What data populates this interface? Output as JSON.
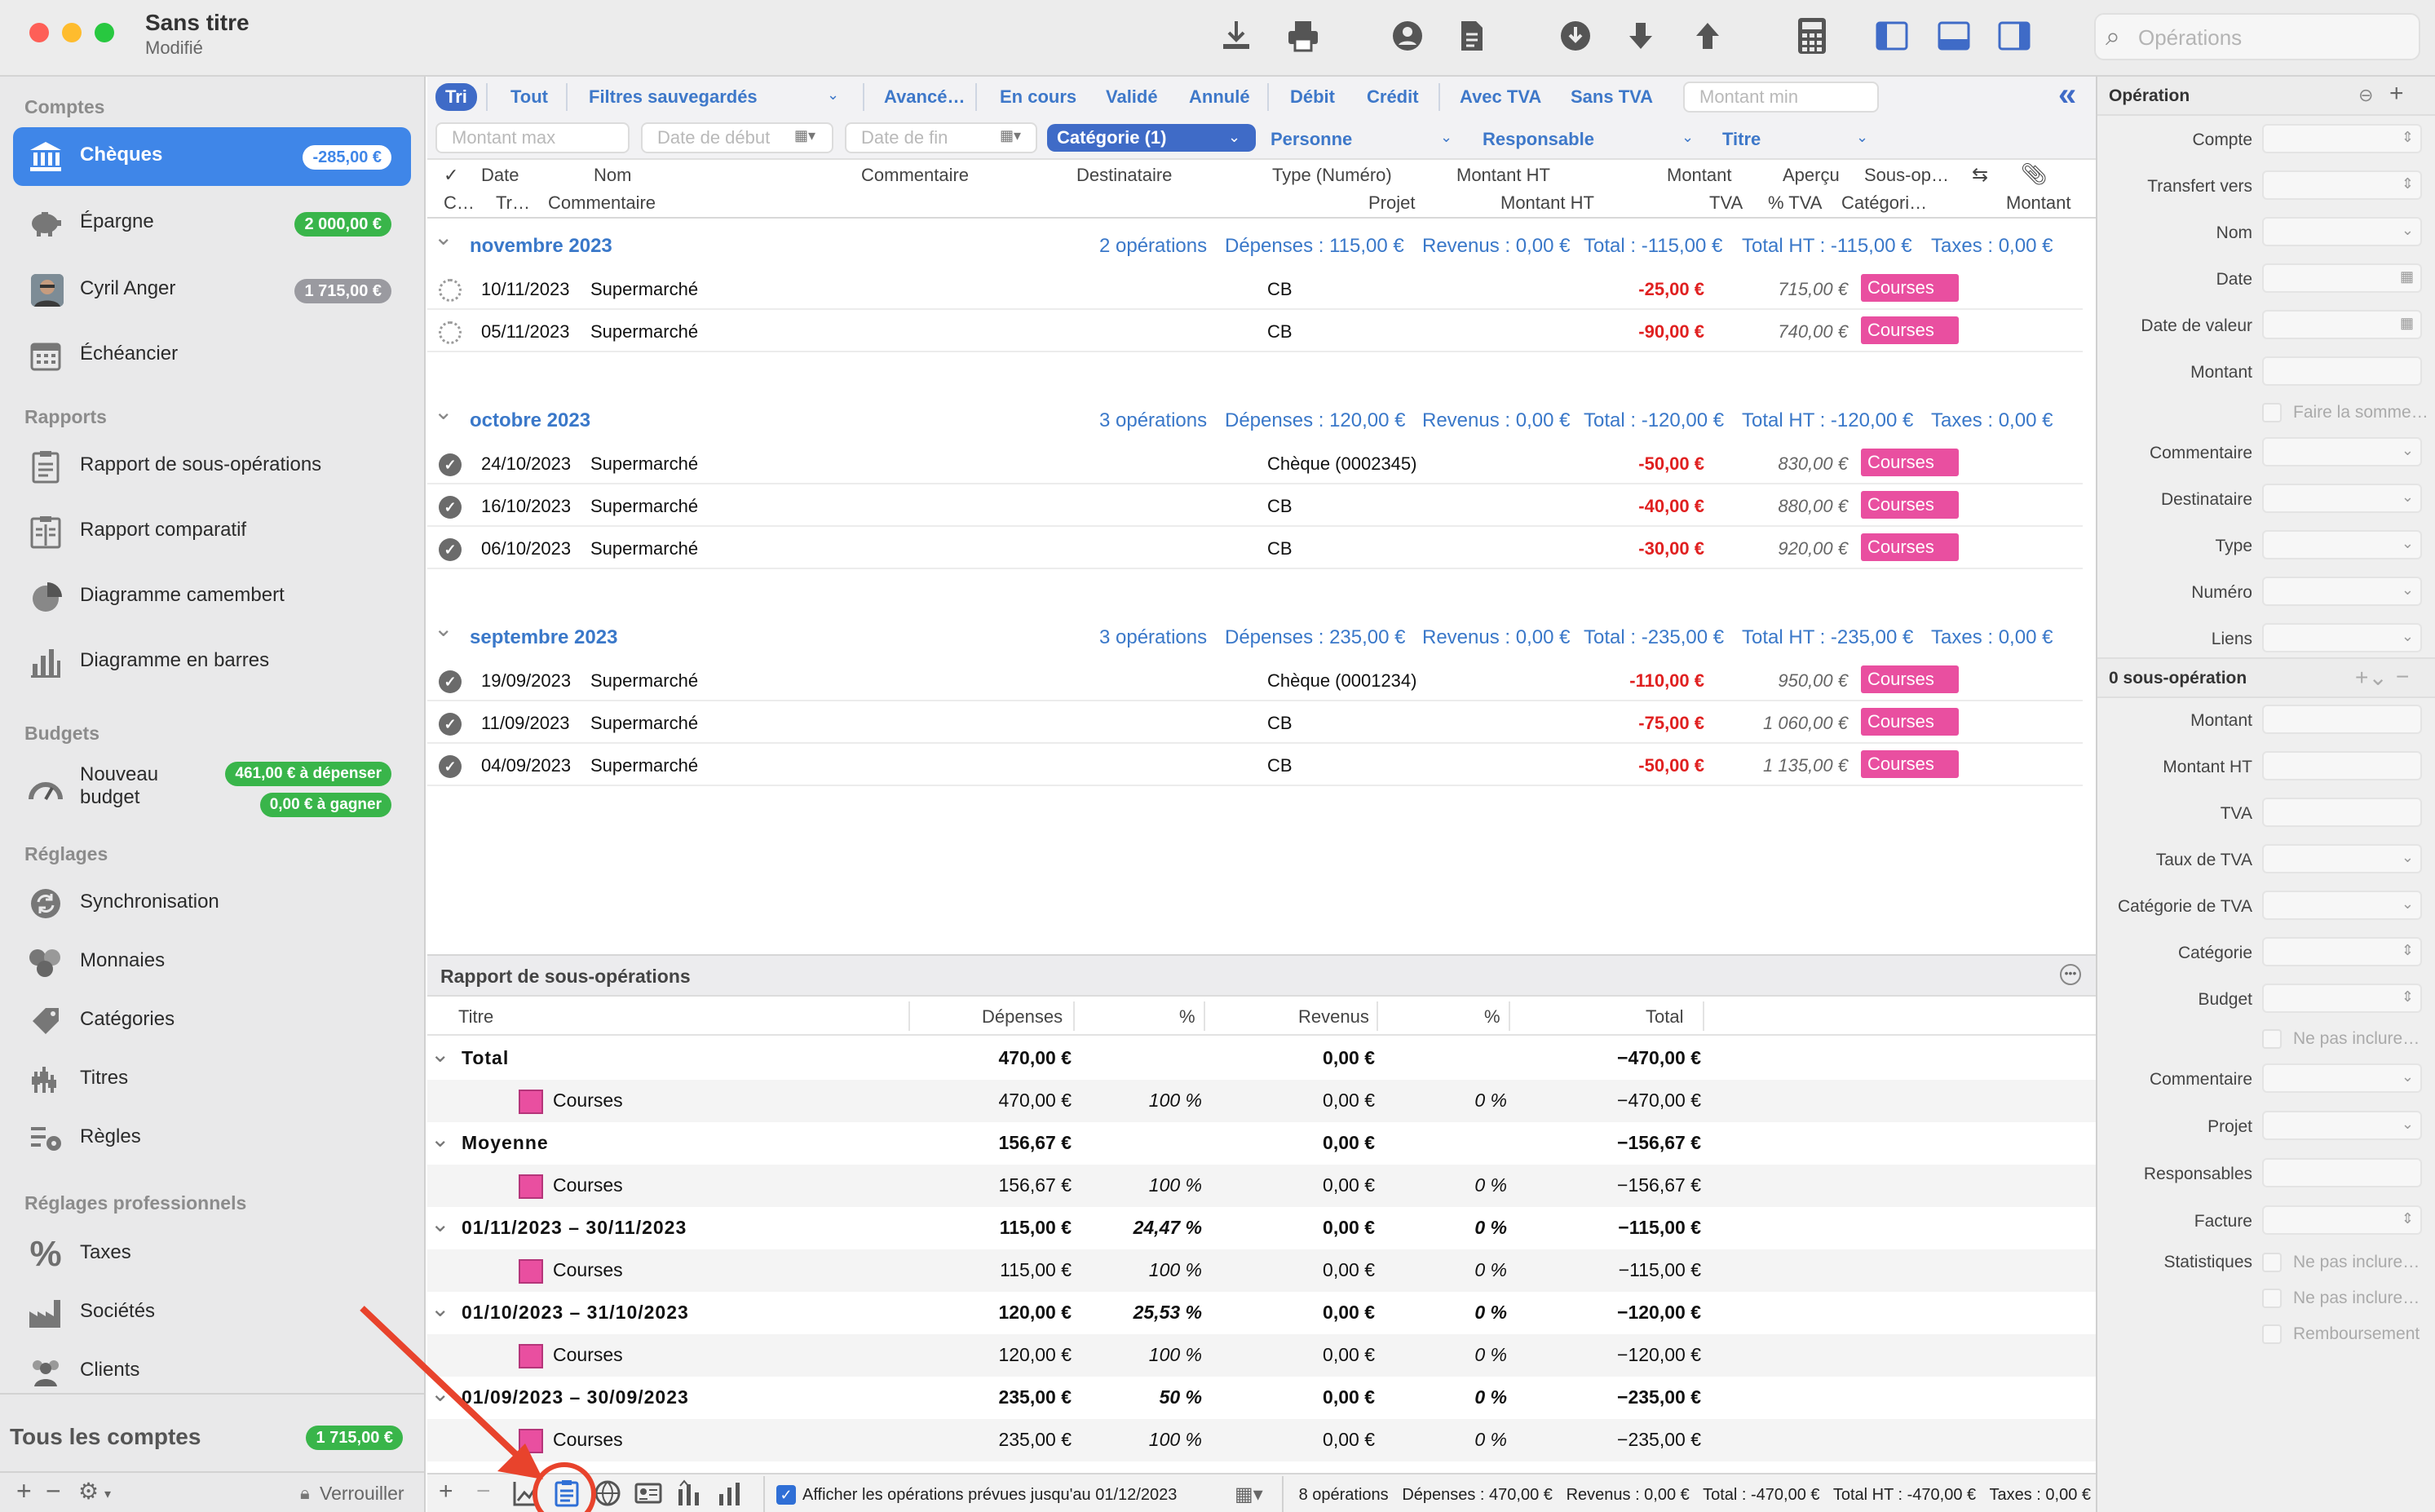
{
  "window": {
    "title": "Sans titre",
    "subtitle": "Modifié"
  },
  "toolbar": {
    "search_placeholder": "Opérations"
  },
  "sidebar": {
    "sec_comptes": "Comptes",
    "accounts": [
      {
        "label": "Chèques",
        "badge": "-285,00 €"
      },
      {
        "label": "Épargne",
        "badge": "2 000,00 €"
      },
      {
        "label": "Cyril Anger",
        "badge": "1 715,00 €"
      },
      {
        "label": "Échéancier"
      }
    ],
    "sec_rapports": "Rapports",
    "reports": [
      "Rapport de sous-opérations",
      "Rapport comparatif",
      "Diagramme camembert",
      "Diagramme en barres"
    ],
    "sec_budgets": "Budgets",
    "budget": {
      "label1": "Nouveau",
      "label2": "budget",
      "badge1": "461,00 € à dépenser",
      "badge2": "0,00 € à gagner"
    },
    "sec_reglages": "Réglages",
    "settings": [
      "Synchronisation",
      "Monnaies",
      "Catégories",
      "Titres",
      "Règles"
    ],
    "sec_pro": "Réglages professionnels",
    "pro": [
      "Taxes",
      "Sociétés",
      "Clients"
    ],
    "total_label": "Tous les comptes",
    "total_badge": "1 715,00 €",
    "lock": "Verrouiller"
  },
  "filters": {
    "row1": [
      "Tri",
      "Tout",
      "Filtres sauvegardés",
      "Avancé…",
      "En cours",
      "Validé",
      "Annulé",
      "Débit",
      "Crédit",
      "Avec TVA",
      "Sans TVA"
    ],
    "montant_min": "Montant min",
    "montant_max": "Montant max",
    "date_debut": "Date de début",
    "date_fin": "Date de fin",
    "categorie": "Catégorie (1)",
    "personne": "Personne",
    "responsable": "Responsable",
    "titre": "Titre"
  },
  "columns": {
    "r1": [
      "✓",
      "Date",
      "Nom",
      "Commentaire",
      "Destinataire",
      "Type (Numéro)",
      "Montant HT",
      "Montant",
      "Aperçu",
      "Sous-op…"
    ],
    "r2": [
      "C…",
      "Tr…",
      "Commentaire",
      "Projet",
      "Montant HT",
      "TVA",
      "% TVA",
      "Catégori…",
      "Montant"
    ]
  },
  "groups": [
    {
      "month": "novembre 2023",
      "count": "2 opérations",
      "dep": "Dépenses : 115,00 €",
      "rev": "Revenus : 0,00 €",
      "tot": "Total : -115,00 €",
      "tht": "Total HT : -115,00 €",
      "tax": "Taxes : 0,00 €",
      "rows": [
        {
          "date": "10/11/2023",
          "nom": "Supermarché",
          "type": "CB",
          "amt": "-25,00 €",
          "bal": "715,00 €",
          "cat": "Courses",
          "pending": true
        },
        {
          "date": "05/11/2023",
          "nom": "Supermarché",
          "type": "CB",
          "amt": "-90,00 €",
          "bal": "740,00 €",
          "cat": "Courses",
          "pending": true
        }
      ]
    },
    {
      "month": "octobre 2023",
      "count": "3 opérations",
      "dep": "Dépenses : 120,00 €",
      "rev": "Revenus : 0,00 €",
      "tot": "Total : -120,00 €",
      "tht": "Total HT : -120,00 €",
      "tax": "Taxes : 0,00 €",
      "rows": [
        {
          "date": "24/10/2023",
          "nom": "Supermarché",
          "type": "Chèque (0002345)",
          "amt": "-50,00 €",
          "bal": "830,00 €",
          "cat": "Courses"
        },
        {
          "date": "16/10/2023",
          "nom": "Supermarché",
          "type": "CB",
          "amt": "-40,00 €",
          "bal": "880,00 €",
          "cat": "Courses"
        },
        {
          "date": "06/10/2023",
          "nom": "Supermarché",
          "type": "CB",
          "amt": "-30,00 €",
          "bal": "920,00 €",
          "cat": "Courses"
        }
      ]
    },
    {
      "month": "septembre 2023",
      "count": "3 opérations",
      "dep": "Dépenses : 235,00 €",
      "rev": "Revenus : 0,00 €",
      "tot": "Total : -235,00 €",
      "tht": "Total HT : -235,00 €",
      "tax": "Taxes : 0,00 €",
      "rows": [
        {
          "date": "19/09/2023",
          "nom": "Supermarché",
          "type": "Chèque (0001234)",
          "amt": "-110,00 €",
          "bal": "950,00 €",
          "cat": "Courses"
        },
        {
          "date": "11/09/2023",
          "nom": "Supermarché",
          "type": "CB",
          "amt": "-75,00 €",
          "bal": "1 060,00 €",
          "cat": "Courses"
        },
        {
          "date": "04/09/2023",
          "nom": "Supermarché",
          "type": "CB",
          "amt": "-50,00 €",
          "bal": "1 135,00 €",
          "cat": "Courses"
        }
      ]
    }
  ],
  "report": {
    "title": "Rapport de sous-opérations",
    "headers": [
      "Titre",
      "Dépenses",
      "%",
      "Revenus",
      "%",
      "Total"
    ],
    "rows": [
      {
        "kind": "head",
        "title": "Total",
        "dep": "470,00 €",
        "pct1": "",
        "rev": "0,00 €",
        "pct2": "",
        "tot": "−470,00 €"
      },
      {
        "kind": "sub",
        "title": "Courses",
        "dep": "470,00 €",
        "pct1": "100 %",
        "rev": "0,00 €",
        "pct2": "0 %",
        "tot": "−470,00 €"
      },
      {
        "kind": "head",
        "title": "Moyenne",
        "dep": "156,67 €",
        "pct1": "",
        "rev": "0,00 €",
        "pct2": "",
        "tot": "−156,67 €"
      },
      {
        "kind": "sub",
        "title": "Courses",
        "dep": "156,67 €",
        "pct1": "100 %",
        "rev": "0,00 €",
        "pct2": "0 %",
        "tot": "−156,67 €"
      },
      {
        "kind": "head",
        "title": "01/11/2023 – 30/11/2023",
        "dep": "115,00 €",
        "pct1": "24,47 %",
        "rev": "0,00 €",
        "pct2": "0 %",
        "tot": "−115,00 €"
      },
      {
        "kind": "sub",
        "title": "Courses",
        "dep": "115,00 €",
        "pct1": "100 %",
        "rev": "0,00 €",
        "pct2": "0 %",
        "tot": "−115,00 €"
      },
      {
        "kind": "head",
        "title": "01/10/2023 – 31/10/2023",
        "dep": "120,00 €",
        "pct1": "25,53 %",
        "rev": "0,00 €",
        "pct2": "0 %",
        "tot": "−120,00 €"
      },
      {
        "kind": "sub",
        "title": "Courses",
        "dep": "120,00 €",
        "pct1": "100 %",
        "rev": "0,00 €",
        "pct2": "0 %",
        "tot": "−120,00 €"
      },
      {
        "kind": "head",
        "title": "01/09/2023 – 30/09/2023",
        "dep": "235,00 €",
        "pct1": "50 %",
        "rev": "0,00 €",
        "pct2": "0 %",
        "tot": "−235,00 €"
      },
      {
        "kind": "sub",
        "title": "Courses",
        "dep": "235,00 €",
        "pct1": "100 %",
        "rev": "0,00 €",
        "pct2": "0 %",
        "tot": "−235,00 €"
      }
    ]
  },
  "bottom": {
    "afficher": "Afficher les opérations prévues jusqu'au 01/12/2023",
    "stats": [
      "8 opérations",
      "Dépenses : 470,00 €",
      "Revenus : 0,00 €",
      "Total : -470,00 €",
      "Total HT : -470,00 €",
      "Taxes : 0,00 €"
    ]
  },
  "inspector": {
    "title": "Opération",
    "fields1": [
      "Compte",
      "Transfert vers",
      "Nom",
      "Date",
      "Date de valeur",
      "Montant"
    ],
    "faire": "Faire la somme…",
    "fields2": [
      "Commentaire",
      "Destinataire",
      "Type",
      "Numéro",
      "Liens"
    ],
    "sub_title": "0 sous-opération",
    "fields3": [
      "Montant",
      "Montant HT",
      "TVA",
      "Taux de TVA",
      "Catégorie de TVA",
      "Catégorie",
      "Budget"
    ],
    "ne_pas": "Ne pas inclure…",
    "fields4": [
      "Commentaire",
      "Projet",
      "Responsables",
      "Facture",
      "Statistiques"
    ],
    "chk": [
      "Ne pas inclure…",
      "Ne pas inclure…",
      "Remboursement"
    ]
  },
  "colors": {
    "accent": "#3f86e8",
    "badge_green": "#39b54a",
    "category": "#e94fa0",
    "negative": "#e02020",
    "annotation": "#e8432c"
  }
}
